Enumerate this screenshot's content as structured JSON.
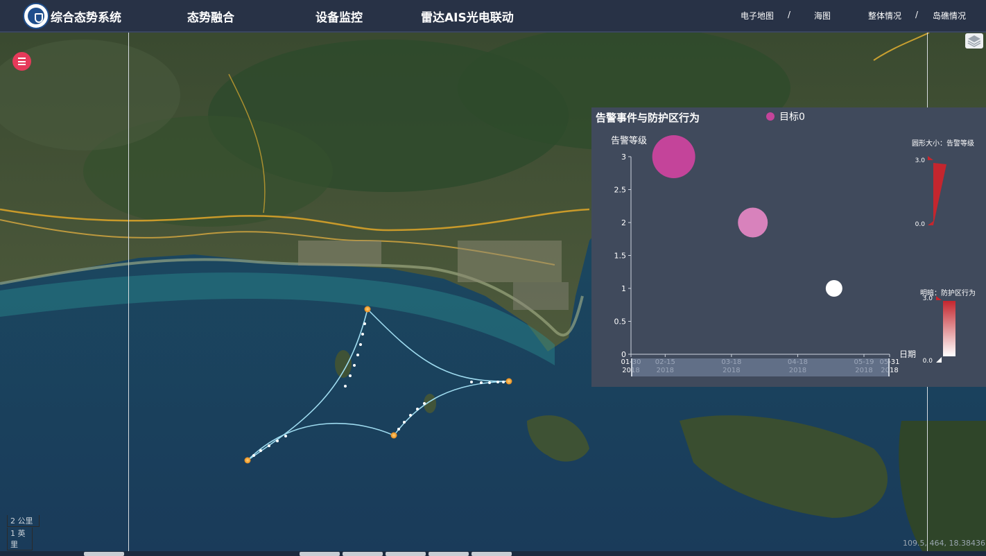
{
  "app": {
    "title": "综合态势系统",
    "nav": [
      "态势融合",
      "设备监控",
      "雷达AIS光电联动"
    ],
    "map_links": [
      "电子地图",
      "海图",
      "整体情况",
      "岛礁情况"
    ],
    "separator": "/"
  },
  "map": {
    "scale_km": "2 公里",
    "scale_mi": "1 英里",
    "coordinates": "109.5, 464, 18.38436",
    "menu_icon": "hamburger-menu-icon",
    "layers_icon": "layers-icon"
  },
  "panel": {
    "title": "告警事件与防护区行为",
    "legend": "目标0",
    "y_title": "告警等级",
    "x_title": "日期",
    "size_map_title": "圆形大小：告警等级",
    "color_map_title": "明暗：防护区行为",
    "size_map_max": "3.0",
    "size_map_min": "0.0",
    "color_map_max": "3.0",
    "color_map_min": "0.0"
  },
  "colors": {
    "panel_bg": "#404a5c",
    "accent_red": "#c4262e",
    "bubble_primary": "#c4449a"
  },
  "chart_data": {
    "type": "scatter",
    "series": [
      {
        "name": "目标0",
        "points": [
          {
            "date": "2018-02-19",
            "level": 3,
            "behavior": 3
          },
          {
            "date": "2018-03-28",
            "level": 2,
            "behavior": 2
          },
          {
            "date": "2018-05-05",
            "level": 1,
            "behavior": 0
          }
        ]
      }
    ],
    "x_ticks": [
      {
        "date": "2018-01-30",
        "label": [
          "01-30",
          "2018"
        ]
      },
      {
        "date": "2018-02-15",
        "label": [
          "02-15",
          "2018"
        ]
      },
      {
        "date": "2018-03-18",
        "label": [
          "03-18",
          "2018"
        ]
      },
      {
        "date": "2018-04-18",
        "label": [
          "04-18",
          "2018"
        ]
      },
      {
        "date": "2018-05-19",
        "label": [
          "05-19",
          "2018"
        ]
      },
      {
        "date": "2018-05-31",
        "label": [
          "05-31",
          "2018"
        ]
      }
    ],
    "ylim": [
      0,
      3
    ],
    "y_ticks": [
      "0",
      "0.5",
      "1",
      "1.5",
      "2",
      "2.5",
      "3"
    ],
    "xlim": [
      "2018-01-30",
      "2018-05-31"
    ],
    "legend_position": "top"
  }
}
